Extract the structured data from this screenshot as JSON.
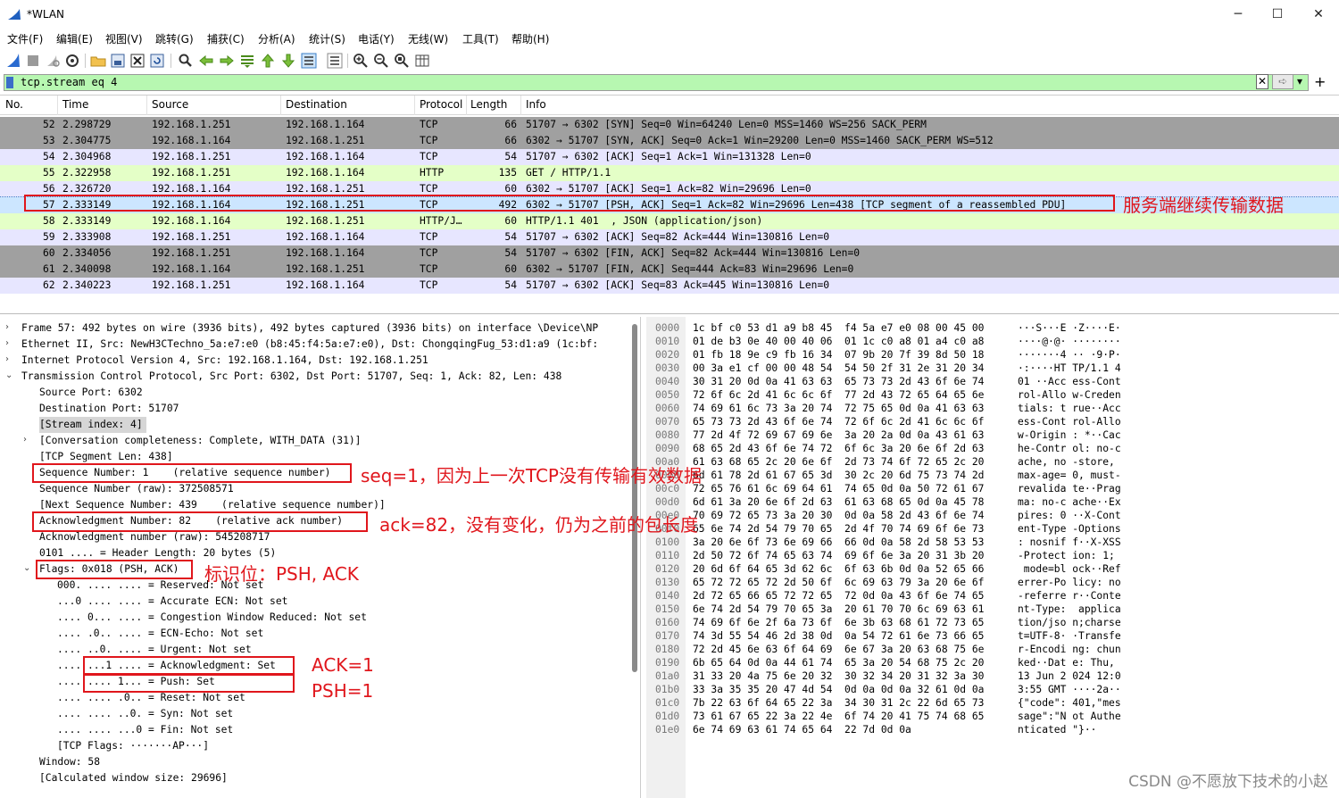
{
  "window": {
    "title": "*WLAN",
    "minimize": "─",
    "maximize": "☐",
    "close": "✕"
  },
  "menu": [
    "文件(F)",
    "编辑(E)",
    "视图(V)",
    "跳转(G)",
    "捕获(C)",
    "分析(A)",
    "统计(S)",
    "电话(Y)",
    "无线(W)",
    "工具(T)",
    "帮助(H)"
  ],
  "toolbar_icons": [
    "shark-fin-start-icon",
    "stop-square-icon",
    "restart-icon",
    "gear-options-icon",
    "open-folder-icon",
    "save-file-icon",
    "close-file-icon",
    "reload-icon",
    "find-icon",
    "go-back-icon",
    "go-forward-icon",
    "go-to-packet-icon",
    "go-first-icon",
    "go-last-icon",
    "autoscroll-icon",
    "colorize-icon",
    "zoom-in-icon",
    "zoom-out-icon",
    "zoom-normal-icon",
    "resize-columns-icon"
  ],
  "filter": {
    "value": "tcp.stream eq 4",
    "clear": "✕",
    "apply": "➪",
    "dropdown": "▾",
    "add": "+"
  },
  "colors": {
    "tcp_gray": "#a0a0a0",
    "tcp_light": "#e7e6ff",
    "http": "#e4ffc7",
    "selected": "#cce6ff",
    "filter_ok": "#b7f7b1",
    "annotation": "#e0161c"
  },
  "packet_list": {
    "columns": [
      "No.",
      "Time",
      "Source",
      "Destination",
      "Protocol",
      "Length",
      "Info"
    ],
    "rows": [
      {
        "no": "52",
        "time": "2.298729",
        "src": "192.168.1.251",
        "dst": "192.168.1.164",
        "proto": "TCP",
        "len": "66",
        "info": "51707 → 6302 [SYN] Seq=0 Win=64240 Len=0 MSS=1460 WS=256 SACK_PERM",
        "style": "tcp"
      },
      {
        "no": "53",
        "time": "2.304775",
        "src": "192.168.1.164",
        "dst": "192.168.1.251",
        "proto": "TCP",
        "len": "66",
        "info": "6302 → 51707 [SYN, ACK] Seq=0 Ack=1 Win=29200 Len=0 MSS=1460 SACK_PERM WS=512",
        "style": "tcp"
      },
      {
        "no": "54",
        "time": "2.304968",
        "src": "192.168.1.251",
        "dst": "192.168.1.164",
        "proto": "TCP",
        "len": "54",
        "info": "51707 → 6302 [ACK] Seq=1 Ack=1 Win=131328 Len=0",
        "style": "tcpplain"
      },
      {
        "no": "55",
        "time": "2.322958",
        "src": "192.168.1.251",
        "dst": "192.168.1.164",
        "proto": "HTTP",
        "len": "135",
        "info": "GET / HTTP/1.1",
        "style": "http"
      },
      {
        "no": "56",
        "time": "2.326720",
        "src": "192.168.1.164",
        "dst": "192.168.1.251",
        "proto": "TCP",
        "len": "60",
        "info": "6302 → 51707 [ACK] Seq=1 Ack=82 Win=29696 Len=0",
        "style": "tcpplain"
      },
      {
        "no": "57",
        "time": "2.333149",
        "src": "192.168.1.164",
        "dst": "192.168.1.251",
        "proto": "TCP",
        "len": "492",
        "info": "6302 → 51707 [PSH, ACK] Seq=1 Ack=82 Win=29696 Len=438 [TCP segment of a reassembled PDU]",
        "style": "selected"
      },
      {
        "no": "58",
        "time": "2.333149",
        "src": "192.168.1.164",
        "dst": "192.168.1.251",
        "proto": "HTTP/J…",
        "len": "60",
        "info": "HTTP/1.1 401  , JSON (application/json)",
        "style": "http"
      },
      {
        "no": "59",
        "time": "2.333908",
        "src": "192.168.1.251",
        "dst": "192.168.1.164",
        "proto": "TCP",
        "len": "54",
        "info": "51707 → 6302 [ACK] Seq=82 Ack=444 Win=130816 Len=0",
        "style": "tcpplain"
      },
      {
        "no": "60",
        "time": "2.334056",
        "src": "192.168.1.251",
        "dst": "192.168.1.164",
        "proto": "TCP",
        "len": "54",
        "info": "51707 → 6302 [FIN, ACK] Seq=82 Ack=444 Win=130816 Len=0",
        "style": "tcp"
      },
      {
        "no": "61",
        "time": "2.340098",
        "src": "192.168.1.164",
        "dst": "192.168.1.251",
        "proto": "TCP",
        "len": "60",
        "info": "6302 → 51707 [FIN, ACK] Seq=444 Ack=83 Win=29696 Len=0",
        "style": "tcp"
      },
      {
        "no": "62",
        "time": "2.340223",
        "src": "192.168.1.251",
        "dst": "192.168.1.164",
        "proto": "TCP",
        "len": "54",
        "info": "51707 → 6302 [ACK] Seq=83 Ack=445 Win=130816 Len=0",
        "style": "tcpplain"
      }
    ]
  },
  "details": [
    {
      "text": "Frame 57: 492 bytes on wire (3936 bits), 492 bytes captured (3936 bits) on interface \\Device\\NP",
      "indent": 0,
      "chev": "›"
    },
    {
      "text": "Ethernet II, Src: NewH3CTechno_5a:e7:e0 (b8:45:f4:5a:e7:e0), Dst: ChongqingFug_53:d1:a9 (1c:bf:",
      "indent": 0,
      "chev": "›"
    },
    {
      "text": "Internet Protocol Version 4, Src: 192.168.1.164, Dst: 192.168.1.251",
      "indent": 0,
      "chev": "›"
    },
    {
      "text": "Transmission Control Protocol, Src Port: 6302, Dst Port: 51707, Seq: 1, Ack: 82, Len: 438",
      "indent": 0,
      "chev": "⌄"
    },
    {
      "text": "Source Port: 6302",
      "indent": 1,
      "chev": ""
    },
    {
      "text": "Destination Port: 51707",
      "indent": 1,
      "chev": ""
    },
    {
      "text": "[Stream index: 4]",
      "indent": 1,
      "chev": "",
      "hl": true
    },
    {
      "text": "[Conversation completeness: Complete, WITH_DATA (31)]",
      "indent": 1,
      "chev": "›"
    },
    {
      "text": "[TCP Segment Len: 438]",
      "indent": 1,
      "chev": ""
    },
    {
      "text": "Sequence Number: 1    (relative sequence number)",
      "indent": 1,
      "chev": ""
    },
    {
      "text": "Sequence Number (raw): 372508571",
      "indent": 1,
      "chev": ""
    },
    {
      "text": "[Next Sequence Number: 439    (relative sequence number)]",
      "indent": 1,
      "chev": ""
    },
    {
      "text": "Acknowledgment Number: 82    (relative ack number)",
      "indent": 1,
      "chev": ""
    },
    {
      "text": "Acknowledgment number (raw): 545208717",
      "indent": 1,
      "chev": ""
    },
    {
      "text": "0101 .... = Header Length: 20 bytes (5)",
      "indent": 1,
      "chev": ""
    },
    {
      "text": "Flags: 0x018 (PSH, ACK)",
      "indent": 1,
      "chev": "⌄"
    },
    {
      "text": "000. .... .... = Reserved: Not set",
      "indent": 2,
      "chev": ""
    },
    {
      "text": "...0 .... .... = Accurate ECN: Not set",
      "indent": 2,
      "chev": ""
    },
    {
      "text": ".... 0... .... = Congestion Window Reduced: Not set",
      "indent": 2,
      "chev": ""
    },
    {
      "text": ".... .0.. .... = ECN-Echo: Not set",
      "indent": 2,
      "chev": ""
    },
    {
      "text": ".... ..0. .... = Urgent: Not set",
      "indent": 2,
      "chev": ""
    },
    {
      "text": ".... ...1 .... = Acknowledgment: Set",
      "indent": 2,
      "chev": ""
    },
    {
      "text": ".... .... 1... = Push: Set",
      "indent": 2,
      "chev": ""
    },
    {
      "text": ".... .... .0.. = Reset: Not set",
      "indent": 2,
      "chev": ""
    },
    {
      "text": ".... .... ..0. = Syn: Not set",
      "indent": 2,
      "chev": ""
    },
    {
      "text": ".... .... ...0 = Fin: Not set",
      "indent": 2,
      "chev": ""
    },
    {
      "text": "[TCP Flags: ·······AP···]",
      "indent": 2,
      "chev": ""
    },
    {
      "text": "Window: 58",
      "indent": 1,
      "chev": ""
    },
    {
      "text": "[Calculated window size: 29696]",
      "indent": 1,
      "chev": ""
    }
  ],
  "hex": [
    {
      "off": "0000",
      "bytes": "1c bf c0 53 d1 a9 b8 45  f4 5a e7 e0 08 00 45 00",
      "ascii": "···S···E ·Z····E·"
    },
    {
      "off": "0010",
      "bytes": "01 de b3 0e 40 00 40 06  01 1c c0 a8 01 a4 c0 a8",
      "ascii": "····@·@· ········"
    },
    {
      "off": "0020",
      "bytes": "01 fb 18 9e c9 fb 16 34  07 9b 20 7f 39 8d 50 18",
      "ascii": "·······4 ·· ·9·P·"
    },
    {
      "off": "0030",
      "bytes": "00 3a e1 cf 00 00 48 54  54 50 2f 31 2e 31 20 34",
      "ascii": "·:····HT TP/1.1 4"
    },
    {
      "off": "0040",
      "bytes": "30 31 20 0d 0a 41 63 63  65 73 73 2d 43 6f 6e 74",
      "ascii": "01 ··Acc ess-Cont"
    },
    {
      "off": "0050",
      "bytes": "72 6f 6c 2d 41 6c 6c 6f  77 2d 43 72 65 64 65 6e",
      "ascii": "rol-Allo w-Creden"
    },
    {
      "off": "0060",
      "bytes": "74 69 61 6c 73 3a 20 74  72 75 65 0d 0a 41 63 63",
      "ascii": "tials: t rue··Acc"
    },
    {
      "off": "0070",
      "bytes": "65 73 73 2d 43 6f 6e 74  72 6f 6c 2d 41 6c 6c 6f",
      "ascii": "ess-Cont rol-Allo"
    },
    {
      "off": "0080",
      "bytes": "77 2d 4f 72 69 67 69 6e  3a 20 2a 0d 0a 43 61 63",
      "ascii": "w-Origin : *··Cac"
    },
    {
      "off": "0090",
      "bytes": "68 65 2d 43 6f 6e 74 72  6f 6c 3a 20 6e 6f 2d 63",
      "ascii": "he-Contr ol: no-c"
    },
    {
      "off": "00a0",
      "bytes": "61 63 68 65 2c 20 6e 6f  2d 73 74 6f 72 65 2c 20",
      "ascii": "ache, no -store, "
    },
    {
      "off": "00b0",
      "bytes": "6d 61 78 2d 61 67 65 3d  30 2c 20 6d 75 73 74 2d",
      "ascii": "max-age= 0, must-"
    },
    {
      "off": "00c0",
      "bytes": "72 65 76 61 6c 69 64 61  74 65 0d 0a 50 72 61 67",
      "ascii": "revalida te··Prag"
    },
    {
      "off": "00d0",
      "bytes": "6d 61 3a 20 6e 6f 2d 63  61 63 68 65 0d 0a 45 78",
      "ascii": "ma: no-c ache··Ex"
    },
    {
      "off": "00e0",
      "bytes": "70 69 72 65 73 3a 20 30  0d 0a 58 2d 43 6f 6e 74",
      "ascii": "pires: 0 ··X-Cont"
    },
    {
      "off": "00f0",
      "bytes": "65 6e 74 2d 54 79 70 65  2d 4f 70 74 69 6f 6e 73",
      "ascii": "ent-Type -Options"
    },
    {
      "off": "0100",
      "bytes": "3a 20 6e 6f 73 6e 69 66  66 0d 0a 58 2d 58 53 53",
      "ascii": ": nosnif f··X-XSS"
    },
    {
      "off": "0110",
      "bytes": "2d 50 72 6f 74 65 63 74  69 6f 6e 3a 20 31 3b 20",
      "ascii": "-Protect ion: 1; "
    },
    {
      "off": "0120",
      "bytes": "20 6d 6f 64 65 3d 62 6c  6f 63 6b 0d 0a 52 65 66",
      "ascii": " mode=bl ock··Ref"
    },
    {
      "off": "0130",
      "bytes": "65 72 72 65 72 2d 50 6f  6c 69 63 79 3a 20 6e 6f",
      "ascii": "errer-Po licy: no"
    },
    {
      "off": "0140",
      "bytes": "2d 72 65 66 65 72 72 65  72 0d 0a 43 6f 6e 74 65",
      "ascii": "-referre r··Conte"
    },
    {
      "off": "0150",
      "bytes": "6e 74 2d 54 79 70 65 3a  20 61 70 70 6c 69 63 61",
      "ascii": "nt-Type:  applica"
    },
    {
      "off": "0160",
      "bytes": "74 69 6f 6e 2f 6a 73 6f  6e 3b 63 68 61 72 73 65",
      "ascii": "tion/jso n;charse"
    },
    {
      "off": "0170",
      "bytes": "74 3d 55 54 46 2d 38 0d  0a 54 72 61 6e 73 66 65",
      "ascii": "t=UTF-8· ·Transfe"
    },
    {
      "off": "0180",
      "bytes": "72 2d 45 6e 63 6f 64 69  6e 67 3a 20 63 68 75 6e",
      "ascii": "r-Encodi ng: chun"
    },
    {
      "off": "0190",
      "bytes": "6b 65 64 0d 0a 44 61 74  65 3a 20 54 68 75 2c 20",
      "ascii": "ked··Dat e: Thu, "
    },
    {
      "off": "01a0",
      "bytes": "31 33 20 4a 75 6e 20 32  30 32 34 20 31 32 3a 30",
      "ascii": "13 Jun 2 024 12:0"
    },
    {
      "off": "01b0",
      "bytes": "33 3a 35 35 20 47 4d 54  0d 0a 0d 0a 32 61 0d 0a",
      "ascii": "3:55 GMT ····2a··"
    },
    {
      "off": "01c0",
      "bytes": "7b 22 63 6f 64 65 22 3a  34 30 31 2c 22 6d 65 73",
      "ascii": "{\"code\": 401,\"mes"
    },
    {
      "off": "01d0",
      "bytes": "73 61 67 65 22 3a 22 4e  6f 74 20 41 75 74 68 65",
      "ascii": "sage\":\"N ot Authe"
    },
    {
      "off": "01e0",
      "bytes": "6e 74 69 63 61 74 65 64  22 7d 0d 0a",
      "ascii": "nticated \"}··"
    }
  ],
  "annotations": {
    "row57": "服务端继续传输数据",
    "seq": "seq=1，因为上一次TCP没有传输有效数据",
    "ack": "ack=82，没有变化，仍为之前的包长度",
    "flags": "标识位：PSH, ACK",
    "ack_flag": "ACK=1",
    "psh_flag": "PSH=1"
  },
  "watermark": "CSDN @不愿放下技术的小赵"
}
